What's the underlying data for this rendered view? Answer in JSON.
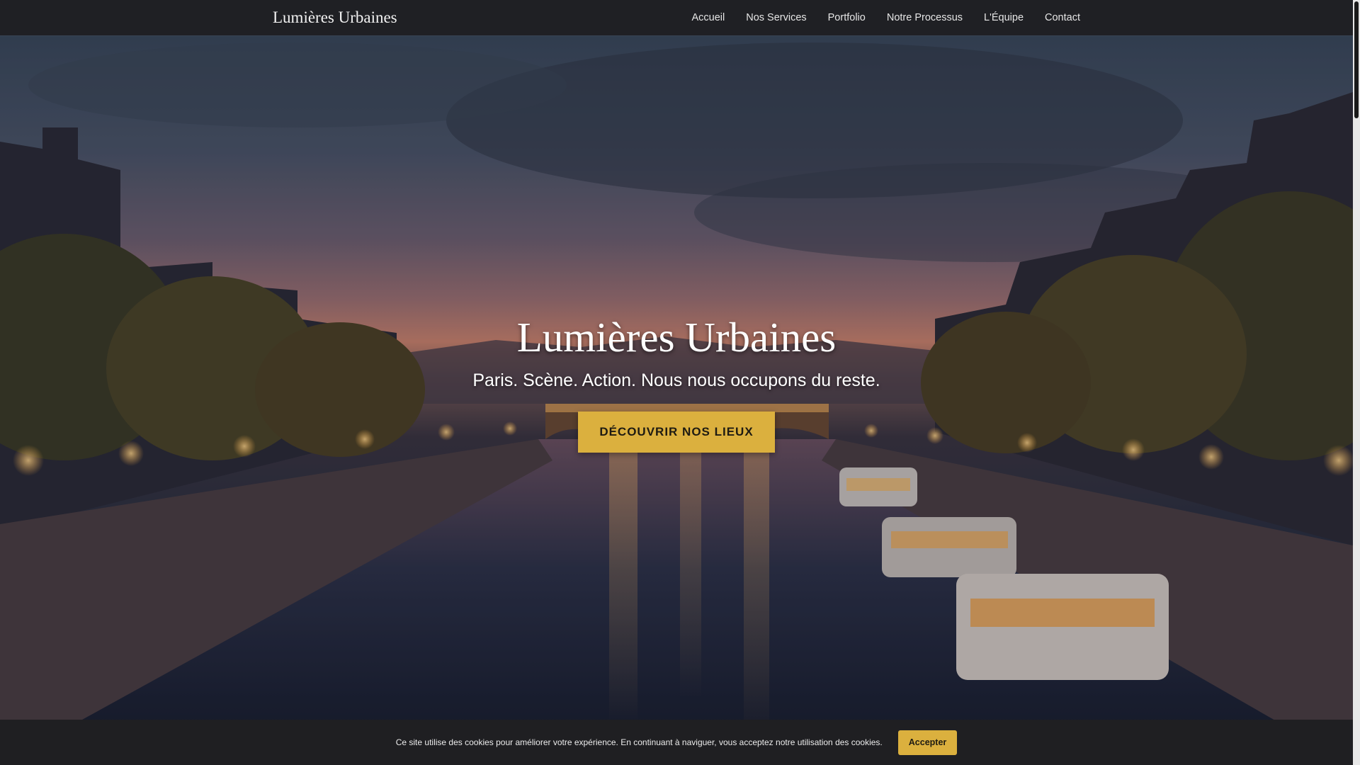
{
  "navbar": {
    "brand": "Lumières Urbaines",
    "links": [
      {
        "label": "Accueil"
      },
      {
        "label": "Nos Services"
      },
      {
        "label": "Portfolio"
      },
      {
        "label": "Notre Processus"
      },
      {
        "label": "L'Équipe"
      },
      {
        "label": "Contact"
      }
    ]
  },
  "hero": {
    "title": "Lumières Urbaines",
    "subtitle": "Paris. Scène. Action. Nous nous occupons du reste.",
    "cta_label": "DÉCOUVRIR NOS LIEUX",
    "image_subject": "Paris canal at dusk with lit boats, bridge and street lamps"
  },
  "cookie_banner": {
    "message": "Ce site utilise des cookies pour améliorer votre expérience. En continuant à naviguer, vous acceptez notre utilisation des cookies.",
    "accept_label": "Accepter"
  },
  "colors": {
    "accent": "#dbb03e",
    "navbar_bg": "#1f2024",
    "banner_bg": "#1f1f22"
  }
}
